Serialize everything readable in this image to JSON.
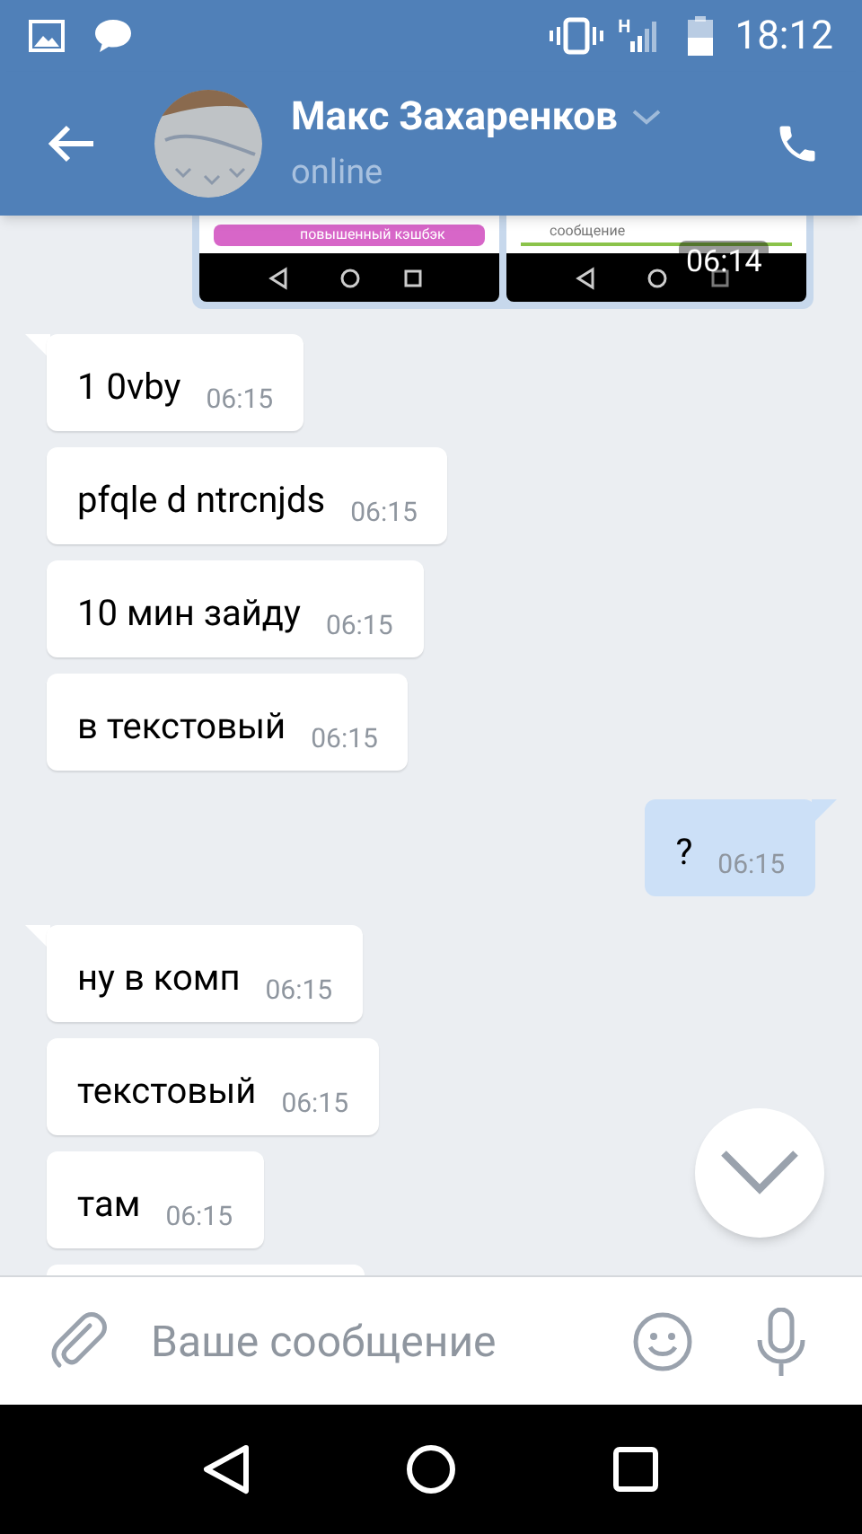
{
  "status_bar": {
    "time": "18:12",
    "network": "H"
  },
  "header": {
    "name": "Макс Захаренков",
    "status": "online"
  },
  "attachment": {
    "thumbnails": [
      {
        "kind": "promo",
        "text": "повышенный кэшбэк"
      },
      {
        "kind": "compose",
        "text": "сообщение"
      }
    ],
    "time": "06:14"
  },
  "messages": [
    {
      "kind": "incoming",
      "tail": true,
      "text": "1 0vby",
      "time": "06:15"
    },
    {
      "kind": "incoming",
      "tail": false,
      "text": "pfqle d ntrcnjds",
      "time": "06:15"
    },
    {
      "kind": "incoming",
      "tail": false,
      "text": "10 мин зайду",
      "time": "06:15"
    },
    {
      "kind": "incoming",
      "tail": false,
      "text": "в текстовый",
      "time": "06:15"
    },
    {
      "kind": "outgoing",
      "tail": true,
      "text": "?",
      "time": "06:15"
    },
    {
      "kind": "incoming",
      "tail": true,
      "text": "ну в комп",
      "time": "06:15"
    },
    {
      "kind": "incoming",
      "tail": false,
      "text": "текстовый",
      "time": "06:15"
    },
    {
      "kind": "incoming",
      "tail": false,
      "text": "там",
      "time": "06:15"
    }
  ],
  "composer": {
    "placeholder": "Ваше сообщение"
  }
}
